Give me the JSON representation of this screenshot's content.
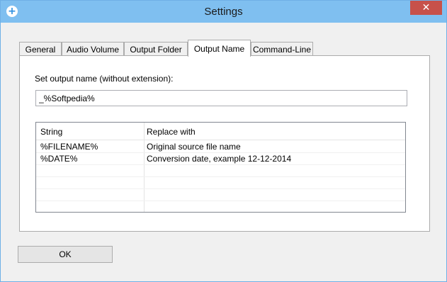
{
  "window": {
    "title": "Settings",
    "close_glyph": "✕",
    "app_icon": "plus-circle-icon"
  },
  "tabs": [
    {
      "label": "General"
    },
    {
      "label": "Audio Volume"
    },
    {
      "label": "Output Folder"
    },
    {
      "label": "Output Name",
      "active": true
    },
    {
      "label": "Command-Line"
    }
  ],
  "output_name": {
    "label": "Set output name (without extension):",
    "value": "_%Softpedia%"
  },
  "table": {
    "columns": [
      "String",
      "Replace with"
    ],
    "rows": [
      [
        "%FILENAME%",
        "Original source file name"
      ],
      [
        "%DATE%",
        "Conversion date, example 12-12-2014"
      ]
    ]
  },
  "buttons": {
    "ok": "OK"
  },
  "colors": {
    "titlebar": "#7fbff0",
    "close_button": "#c7514a"
  }
}
